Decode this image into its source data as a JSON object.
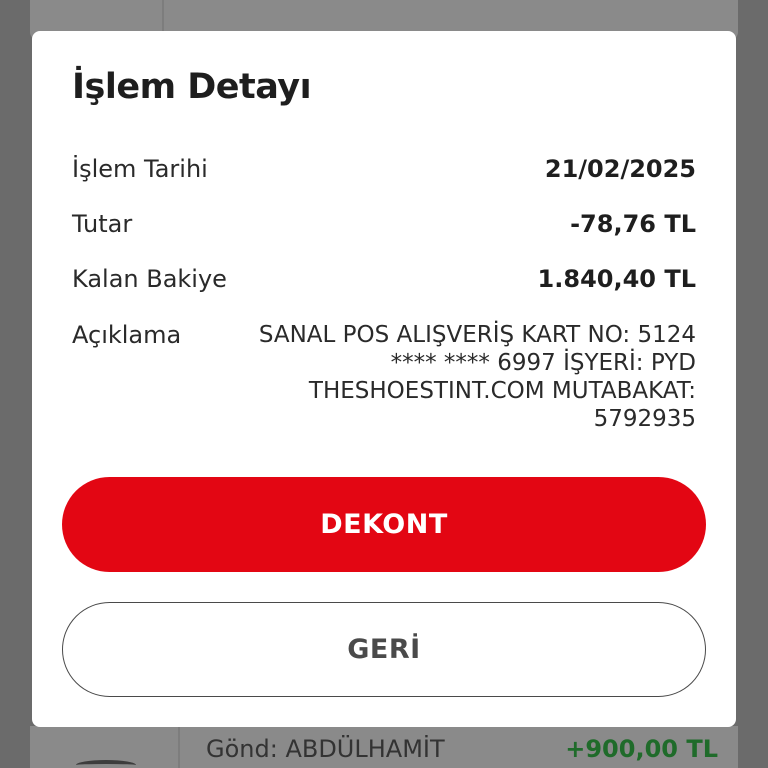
{
  "background": {
    "list_item_sender": "Gönd: ABDÜLHAMİT",
    "list_item_amount": "+900,00 TL"
  },
  "modal": {
    "title": "İşlem Detayı",
    "rows": {
      "date": {
        "label": "İşlem Tarihi",
        "value": "21/02/2025"
      },
      "amount": {
        "label": "Tutar",
        "value": "-78,76 TL"
      },
      "balance": {
        "label": "Kalan Bakiye",
        "value": "1.840,40 TL"
      },
      "description": {
        "label": "Açıklama",
        "value": "SANAL POS ALIŞVERİŞ KART NO: 5124 **** **** 6997 İŞYERİ: PYD THESHOESTINT.COM MUTABAKAT: 5792935"
      }
    },
    "buttons": {
      "receipt": "DEKONT",
      "back": "GERİ"
    }
  },
  "colors": {
    "primary_red": "#e30613",
    "overlay": "#6b6b6b",
    "positive_green": "#1f6b2a"
  }
}
